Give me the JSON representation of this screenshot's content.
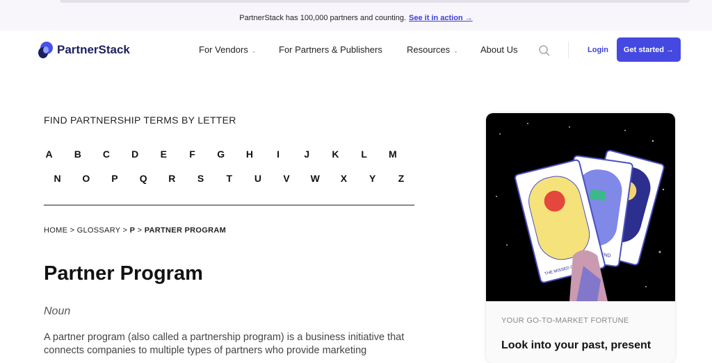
{
  "announcement": {
    "text": "PartnerStack has 100,000 partners and counting.",
    "link": "See it in action →"
  },
  "header": {
    "brand": "PartnerStack",
    "nav": [
      {
        "label": "For Vendors",
        "dropdown": true
      },
      {
        "label": "For Partners & Publishers",
        "dropdown": false
      },
      {
        "label": "Resources",
        "dropdown": true
      },
      {
        "label": "About Us",
        "dropdown": false
      }
    ],
    "login": "Login",
    "cta": "Get started →",
    "accent": "#4549e0"
  },
  "glossary": {
    "heading": "FIND PARTNERSHIP TERMS BY LETTER",
    "row1": [
      "A",
      "B",
      "C",
      "D",
      "E",
      "F",
      "G",
      "H",
      "I",
      "J",
      "K",
      "L",
      "M"
    ],
    "row2": [
      "N",
      "O",
      "P",
      "Q",
      "R",
      "S",
      "T",
      "U",
      "V",
      "W",
      "X",
      "Y",
      "Z"
    ]
  },
  "breadcrumb": {
    "home": "HOME",
    "sep1": ">",
    "glossary": "GLOSSARY",
    "sep2": ">",
    "letter": "P",
    "sep3": ">",
    "current": "PARTNER PROGRAM"
  },
  "article": {
    "title": "Partner Program",
    "pos": "Noun",
    "body": "A partner program (also called a partnership program) is a business initiative that connects companies to multiple types of partners who provide marketing"
  },
  "promo": {
    "eyebrow": "YOUR GO-TO-MARKET FORTUNE",
    "title": "Look into your past, present",
    "card_captions": [
      "THE MISSED CONNECTION",
      "SPEND"
    ]
  }
}
